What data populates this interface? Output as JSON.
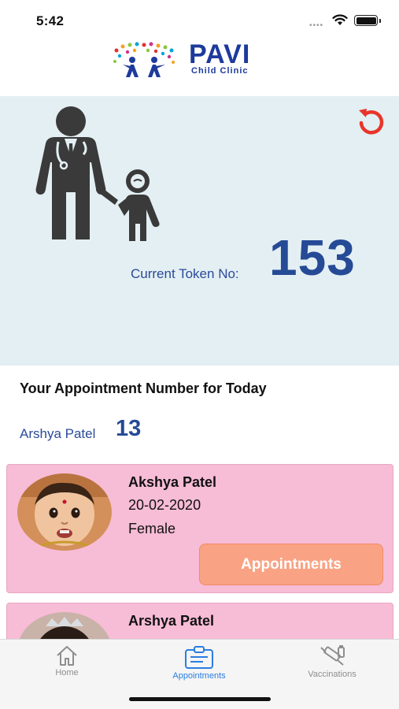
{
  "status_bar": {
    "time": "5:42"
  },
  "header": {
    "brand_name": "PAVI",
    "brand_subtitle": "Child Clinic"
  },
  "token_panel": {
    "label": "Current Token No:",
    "token_number": "153"
  },
  "today": {
    "heading": "Your Appointment Number for Today",
    "patient_name": "Arshya Patel",
    "appointment_number": "13"
  },
  "patients": [
    {
      "name": "Akshya Patel",
      "dob": "20-02-2020",
      "gender": "Female",
      "button_label": "Appointments"
    },
    {
      "name": "Arshya Patel",
      "dob": "",
      "gender": "",
      "button_label": ""
    }
  ],
  "tabs": [
    {
      "label": "Home",
      "icon": "home-icon",
      "active": false
    },
    {
      "label": "Appointments",
      "icon": "appointment-clipboard-icon",
      "active": true
    },
    {
      "label": "Vaccinations",
      "icon": "syringe-icon",
      "active": false
    }
  ],
  "colors": {
    "brand_blue": "#1d3a9c",
    "token_panel_bg": "#e3eff2",
    "card_pink": "#f7bcd6",
    "button_orange": "#f9a384",
    "refresh_red": "#e8352b",
    "active_tab": "#2a7de1"
  }
}
